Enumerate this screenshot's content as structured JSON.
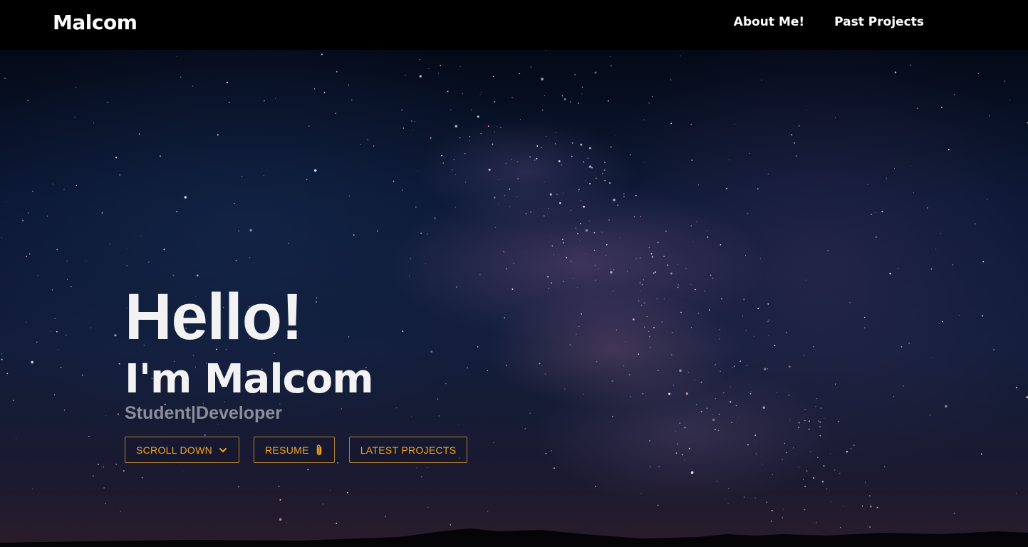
{
  "nav": {
    "brand": "Malcom",
    "links": [
      {
        "label": "About Me!"
      },
      {
        "label": "Past Projects"
      }
    ]
  },
  "hero": {
    "greeting": "Hello!",
    "name": "I'm Malcom",
    "subtitle": "Student|Developer",
    "buttons": [
      {
        "label": "SCROLL DOWN",
        "icon": "chevron-down-icon"
      },
      {
        "label": "RESUME",
        "icon": "paperclip-icon"
      },
      {
        "label": "LATEST PROJECTS",
        "icon": ""
      }
    ]
  },
  "colors": {
    "navbar_bg": "#000000",
    "accent": "#f0a522",
    "subtitle": "#8a8f99",
    "heading": "#f2f2f2"
  }
}
